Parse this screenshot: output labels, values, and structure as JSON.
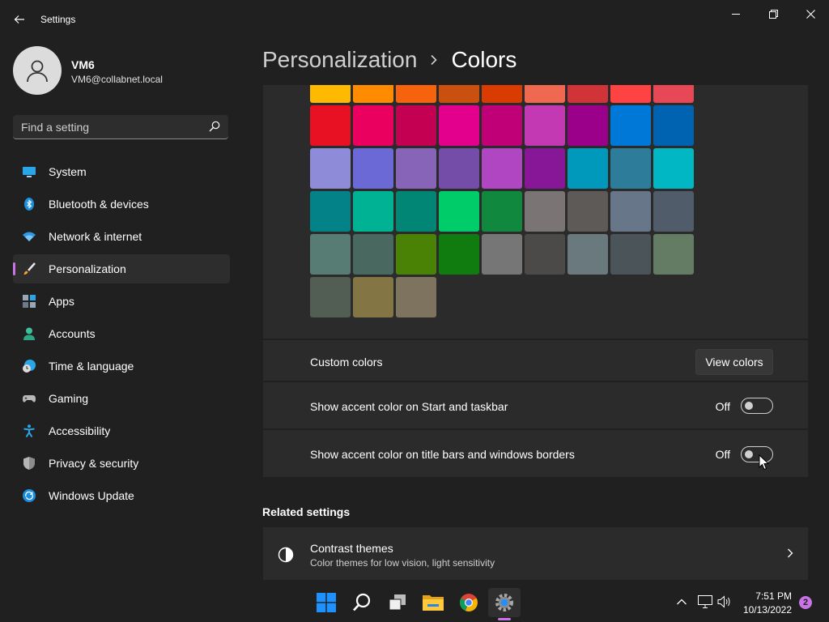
{
  "window": {
    "title": "Settings"
  },
  "user": {
    "name": "VM6",
    "email": "VM6@collabnet.local"
  },
  "search": {
    "placeholder": "Find a setting"
  },
  "nav": {
    "items": [
      {
        "label": "System",
        "icon": "monitor-icon"
      },
      {
        "label": "Bluetooth & devices",
        "icon": "bluetooth-icon"
      },
      {
        "label": "Network & internet",
        "icon": "wifi-icon"
      },
      {
        "label": "Personalization",
        "icon": "brush-icon",
        "selected": true
      },
      {
        "label": "Apps",
        "icon": "apps-icon"
      },
      {
        "label": "Accounts",
        "icon": "person-icon"
      },
      {
        "label": "Time & language",
        "icon": "clock-globe-icon"
      },
      {
        "label": "Gaming",
        "icon": "gamepad-icon"
      },
      {
        "label": "Accessibility",
        "icon": "accessibility-icon"
      },
      {
        "label": "Privacy & security",
        "icon": "shield-icon"
      },
      {
        "label": "Windows Update",
        "icon": "update-icon"
      }
    ],
    "accent": "#c974e6"
  },
  "header": {
    "parent": "Personalization",
    "current": "Colors"
  },
  "swatches": [
    [
      "#ffb900",
      "#ff8c00",
      "#f7630c",
      "#ca5010",
      "#da3b01",
      "#ef6950",
      "#d13438",
      "#ff4343",
      "#e74856"
    ],
    [
      "#e81123",
      "#ea005e",
      "#c30052",
      "#e3008c",
      "#bf0077",
      "#c239b3",
      "#9a0089",
      "#0078d7",
      "#0063b1"
    ],
    [
      "#8e8cd8",
      "#6b69d6",
      "#8764b8",
      "#744da9",
      "#b146c2",
      "#881798",
      "#0099bc",
      "#2d7d9a",
      "#00b7c3"
    ],
    [
      "#038387",
      "#00b294",
      "#018574",
      "#00cc6a",
      "#10893e",
      "#7a7574",
      "#5d5a58",
      "#68768a",
      "#515c6b"
    ],
    [
      "#567c73",
      "#486860",
      "#498205",
      "#107c10",
      "#767676",
      "#4c4a48",
      "#69797e",
      "#4a5459",
      "#647c64"
    ],
    [
      "#525e54",
      "#847545",
      "#7e735f"
    ]
  ],
  "custom_colors": {
    "label": "Custom colors",
    "button": "View colors"
  },
  "accent_start": {
    "label": "Show accent color on Start and taskbar",
    "state": "Off"
  },
  "accent_titlebars": {
    "label": "Show accent color on title bars and windows borders",
    "state": "Off"
  },
  "related": {
    "title": "Related settings",
    "contrast": {
      "title": "Contrast themes",
      "subtitle": "Color themes for low vision, light sensitivity"
    }
  },
  "taskbar": {
    "time": "7:51 PM",
    "date": "10/13/2022",
    "notifications": "2",
    "apps": [
      "start-icon",
      "search-icon",
      "task-view-icon",
      "file-explorer-icon",
      "chrome-icon",
      "settings-icon"
    ]
  }
}
